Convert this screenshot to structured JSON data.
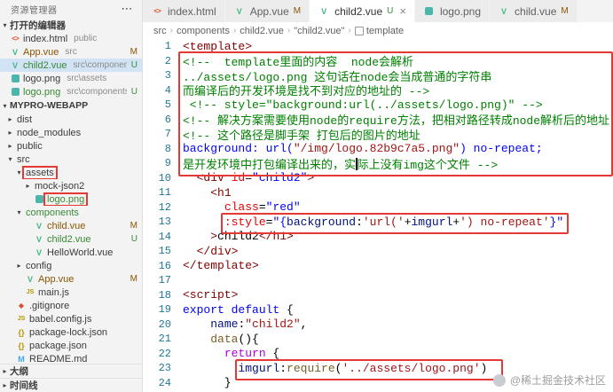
{
  "colors": {
    "annotation": "#e53935",
    "modified": "#895503",
    "untracked": "#388a34",
    "accent": "#0060c0"
  },
  "explorer": {
    "title": "资源管理器",
    "more_icon": "⋯",
    "open_editors_label": "打开的编辑器",
    "project_label": "MYPRO-WEBAPP",
    "open_editors": [
      {
        "name": "index.html",
        "path": "public",
        "icon": "html",
        "badge": "",
        "git": "",
        "selected": false
      },
      {
        "name": "App.vue",
        "path": "src",
        "icon": "vue",
        "badge": "M",
        "git": "m",
        "selected": false
      },
      {
        "name": "child2.vue",
        "path": "src\\components",
        "icon": "vue",
        "badge": "U",
        "git": "u",
        "selected": true
      },
      {
        "name": "logo.png",
        "path": "src\\assets",
        "icon": "img",
        "badge": "",
        "git": "",
        "selected": false
      },
      {
        "name": "logo.png",
        "path": "src\\components",
        "icon": "img",
        "badge": "U",
        "git": "u",
        "selected": false
      }
    ],
    "tree": [
      {
        "label": "dist",
        "type": "folder",
        "level": 0,
        "expanded": false
      },
      {
        "label": "node_modules",
        "type": "folder",
        "level": 0,
        "expanded": false
      },
      {
        "label": "public",
        "type": "folder",
        "level": 0,
        "expanded": false
      },
      {
        "label": "src",
        "type": "folder",
        "level": 0,
        "expanded": true
      },
      {
        "label": "assets",
        "type": "folder",
        "level": 1,
        "expanded": true,
        "boxed": true
      },
      {
        "label": "mock-json2",
        "type": "folder",
        "level": 2,
        "expanded": false
      },
      {
        "label": "logo.png",
        "type": "file",
        "icon": "img",
        "level": 2,
        "git": "u",
        "boxed": true
      },
      {
        "label": "components",
        "type": "folder",
        "level": 1,
        "expanded": true,
        "git": "u"
      },
      {
        "label": "child.vue",
        "type": "file",
        "icon": "vue",
        "level": 2,
        "git": "m",
        "badge": "M"
      },
      {
        "label": "child2.vue",
        "type": "file",
        "icon": "vue",
        "level": 2,
        "git": "u",
        "badge": "U"
      },
      {
        "label": "HelloWorld.vue",
        "type": "file",
        "icon": "vue",
        "level": 2
      },
      {
        "label": "config",
        "type": "folder",
        "level": 1,
        "expanded": false
      },
      {
        "label": "App.vue",
        "type": "file",
        "icon": "vue",
        "level": 1,
        "git": "m",
        "badge": "M"
      },
      {
        "label": "main.js",
        "type": "file",
        "icon": "js",
        "level": 1
      },
      {
        "label": ".gitignore",
        "type": "file",
        "icon": "git",
        "level": 0
      },
      {
        "label": "babel.config.js",
        "type": "file",
        "icon": "js",
        "level": 0
      },
      {
        "label": "package-lock.json",
        "type": "file",
        "icon": "json",
        "level": 0
      },
      {
        "label": "package.json",
        "type": "file",
        "icon": "json",
        "level": 0
      },
      {
        "label": "README.md",
        "type": "file",
        "icon": "md",
        "level": 0
      }
    ],
    "outline_label": "大纲",
    "timeline_label": "时间线"
  },
  "tabs": [
    {
      "label": "index.html",
      "icon": "html",
      "badge": "",
      "active": false
    },
    {
      "label": "App.vue",
      "icon": "vue",
      "badge": "M",
      "active": false
    },
    {
      "label": "child2.vue",
      "icon": "vue",
      "badge": "U",
      "active": true
    },
    {
      "label": "logo.png",
      "icon": "img",
      "badge": "",
      "active": false
    },
    {
      "label": "child.vue",
      "icon": "vue",
      "badge": "M",
      "active": false
    }
  ],
  "breadcrumb": {
    "items": [
      "src",
      "components",
      "child2.vue",
      "\"child2.vue\"",
      "template"
    ]
  },
  "editor": {
    "lines": [
      {
        "n": 1,
        "tokens": [
          [
            "tag",
            "<template>"
          ]
        ]
      },
      {
        "n": 2,
        "tokens": [
          [
            "com",
            "<!--  template里面的内容  node会解析"
          ]
        ]
      },
      {
        "n": 3,
        "tokens": [
          [
            "com",
            "../assets/logo.png 这句话在node会当成普通的字符串"
          ]
        ]
      },
      {
        "n": 4,
        "tokens": [
          [
            "com",
            "而编译后的开发环境是找不到对应的地址的 -->"
          ]
        ]
      },
      {
        "n": 5,
        "tokens": [
          [
            "com",
            " <!-- style=\"background:url(../assets/logo.png)\" -->"
          ]
        ]
      },
      {
        "n": 6,
        "tokens": [
          [
            "com",
            "<!-- 解决方案需要使用node的require方法，把相对路径转成node解析后的地址 -->"
          ]
        ]
      },
      {
        "n": 7,
        "tokens": [
          [
            "com",
            "<!-- 这个路径是脚手架 打包后的图片的地址"
          ]
        ]
      },
      {
        "n": 8,
        "tokens": [
          [
            "str",
            "background: url("
          ],
          [
            "jstr",
            "\"/img/logo.82b9c7a5.png\""
          ],
          [
            "str",
            ") no-repeat;"
          ]
        ]
      },
      {
        "n": 9,
        "tokens": [
          [
            "com",
            "是开发环境中打包编译出来的，实"
          ],
          [
            "cur",
            ""
          ],
          [
            "com",
            "际上没有img这个文件 -->"
          ]
        ]
      },
      {
        "n": 10,
        "tokens": [
          [
            "txt",
            "  "
          ],
          [
            "tag",
            "<div "
          ],
          [
            "attr",
            "id"
          ],
          [
            "txt",
            "="
          ],
          [
            "str",
            "\"child2\""
          ],
          [
            "tag",
            ">"
          ]
        ]
      },
      {
        "n": 11,
        "tokens": [
          [
            "txt",
            "    "
          ],
          [
            "tag",
            "<h1"
          ]
        ]
      },
      {
        "n": 12,
        "tokens": [
          [
            "txt",
            "      "
          ],
          [
            "attr",
            "class"
          ],
          [
            "txt",
            "="
          ],
          [
            "str",
            "\"red\""
          ]
        ]
      },
      {
        "n": 13,
        "tokens": [
          [
            "txt",
            "      "
          ],
          [
            "attr",
            ":style"
          ],
          [
            "txt",
            "="
          ],
          [
            "str",
            "\"{"
          ],
          [
            "prop",
            "background"
          ],
          [
            "txt",
            ":"
          ],
          [
            "jstr",
            "'url('"
          ],
          [
            "txt",
            "+"
          ],
          [
            "prop",
            "imgurl"
          ],
          [
            "txt",
            "+"
          ],
          [
            "jstr",
            "') no-repeat'"
          ],
          [
            "str",
            "}\""
          ]
        ]
      },
      {
        "n": 14,
        "tokens": [
          [
            "txt",
            "    "
          ],
          [
            "tag",
            ">"
          ],
          [
            "txt",
            "child2"
          ],
          [
            "tag",
            "</h1>"
          ]
        ]
      },
      {
        "n": 15,
        "tokens": [
          [
            "txt",
            "  "
          ],
          [
            "tag",
            "</div>"
          ]
        ]
      },
      {
        "n": 16,
        "tokens": [
          [
            "tag",
            "</template>"
          ]
        ]
      },
      {
        "n": 17,
        "tokens": []
      },
      {
        "n": 18,
        "tokens": [
          [
            "tag",
            "<script>"
          ]
        ]
      },
      {
        "n": 19,
        "tokens": [
          [
            "kw",
            "export default"
          ],
          [
            "txt",
            " {"
          ]
        ]
      },
      {
        "n": 20,
        "tokens": [
          [
            "txt",
            "    "
          ],
          [
            "prop",
            "name"
          ],
          [
            "txt",
            ":"
          ],
          [
            "jstr",
            "\"child2\""
          ],
          [
            "txt",
            ","
          ]
        ]
      },
      {
        "n": 21,
        "tokens": [
          [
            "txt",
            "    "
          ],
          [
            "fn",
            "data"
          ],
          [
            "txt",
            "(){"
          ]
        ]
      },
      {
        "n": 22,
        "tokens": [
          [
            "txt",
            "      "
          ],
          [
            "ctl",
            "return"
          ],
          [
            "txt",
            " {"
          ]
        ]
      },
      {
        "n": 23,
        "tokens": [
          [
            "txt",
            "        "
          ],
          [
            "prop",
            "imgurl"
          ],
          [
            "txt",
            ":"
          ],
          [
            "fn",
            "require"
          ],
          [
            "txt",
            "("
          ],
          [
            "jstr",
            "'../assets/logo.png'"
          ],
          [
            "txt",
            ")"
          ]
        ]
      },
      {
        "n": 24,
        "tokens": [
          [
            "txt",
            "      }"
          ]
        ]
      }
    ]
  },
  "watermark": {
    "text": "@稀土掘金技术社区"
  }
}
